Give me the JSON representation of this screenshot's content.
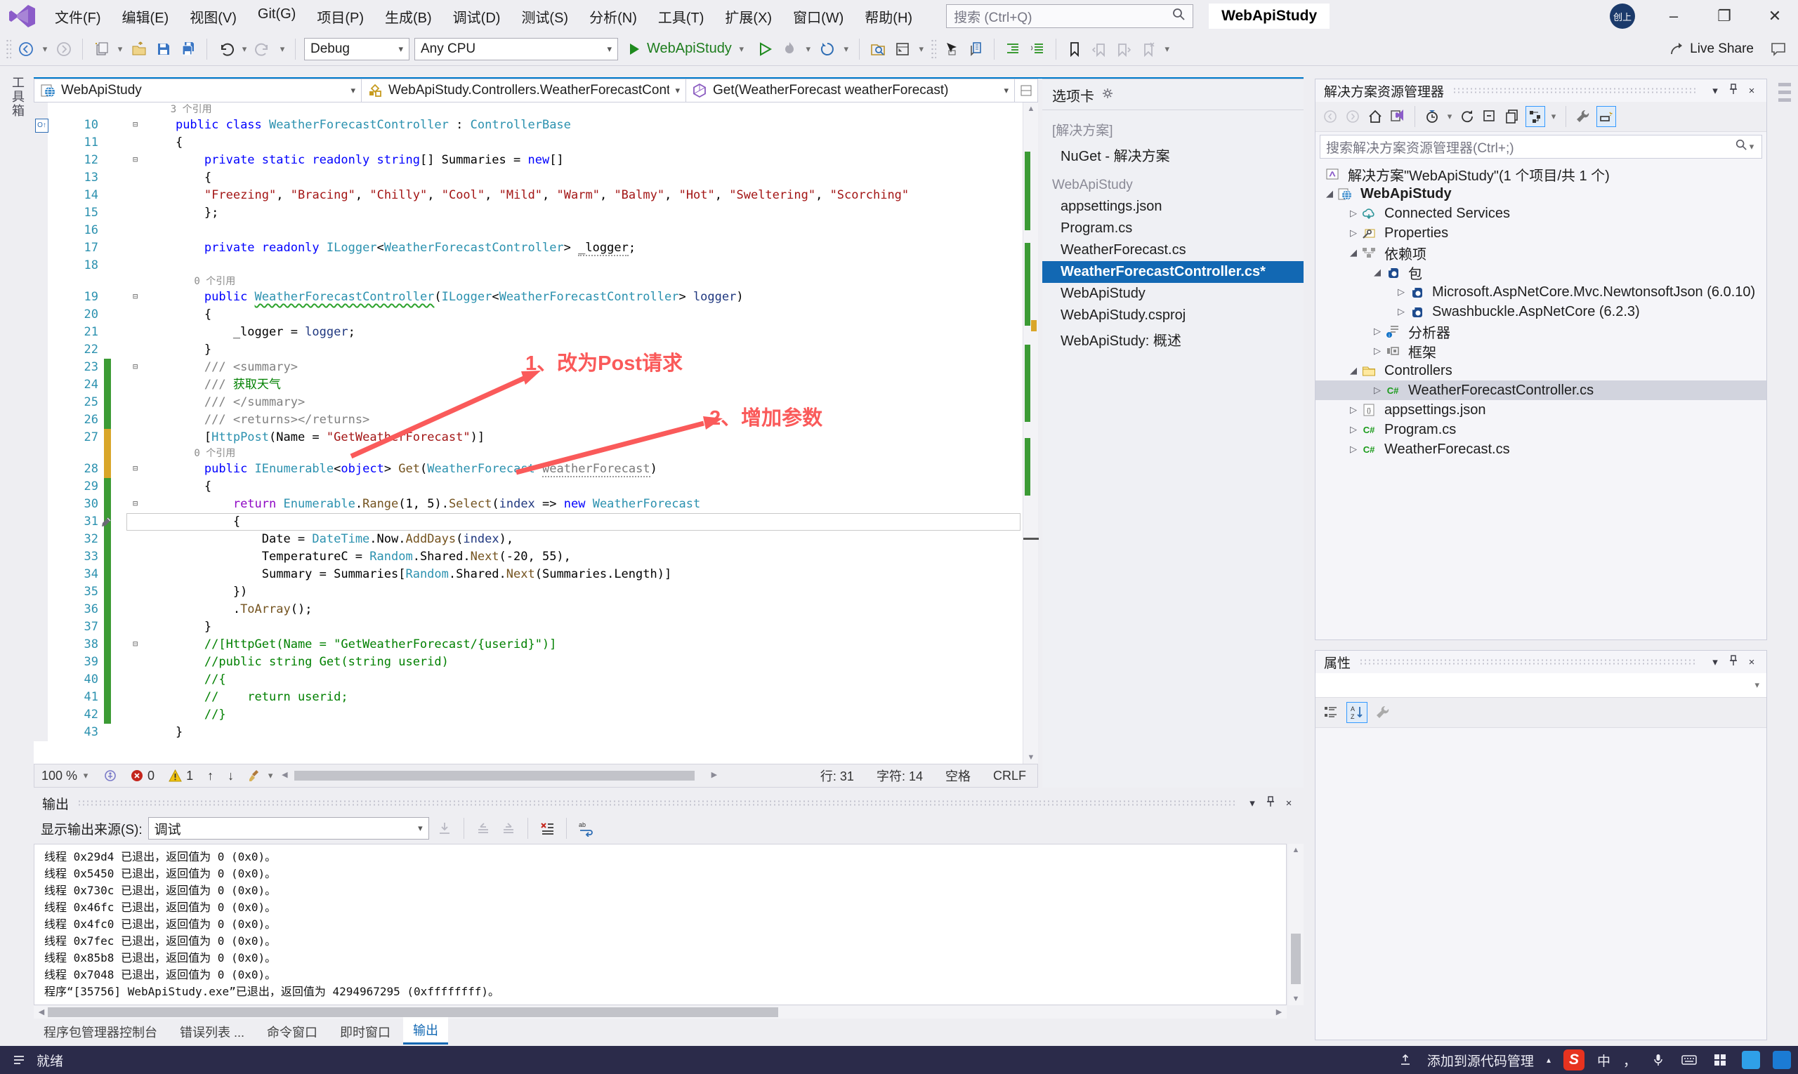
{
  "colors": {
    "accent": "#007ACC",
    "selection_blue": "#1268B3",
    "change_green": "#3C9B35",
    "change_orange": "#D9A629",
    "annotation_red": "#FA5A5A",
    "keyword_blue": "#0000FF",
    "type_teal": "#2B91AF",
    "string_red": "#A31515",
    "comment_green": "#008000"
  },
  "titlebar": {
    "menus": [
      "文件(F)",
      "编辑(E)",
      "视图(V)",
      "Git(G)",
      "项目(P)",
      "生成(B)",
      "调试(D)",
      "测试(S)",
      "分析(N)",
      "工具(T)",
      "扩展(X)",
      "窗口(W)",
      "帮助(H)"
    ],
    "search_placeholder": "搜索 (Ctrl+Q)",
    "window_title": "WebApiStudy",
    "avatar": "创上",
    "minimize": "–",
    "restore": "❐",
    "close": "✕"
  },
  "toolbar": {
    "configuration": "Debug",
    "platform": "Any CPU",
    "run_target": "WebApiStudy",
    "live_share": "Live Share"
  },
  "left_strip": {
    "toolbox_tab": "工具箱"
  },
  "navbar": {
    "project": "WebApiStudy",
    "type": "WebApiStudy.Controllers.WeatherForecastCont",
    "member": "Get(WeatherForecast weatherForecast)"
  },
  "editor": {
    "lines": [
      {
        "h": 1,
        "segs": [
          [
            "    3 个引用",
            "g"
          ]
        ]
      },
      {
        "n": "10",
        "fold": 1,
        "glyph": "ref",
        "segs": [
          [
            "    ",
            "x"
          ],
          [
            "public class ",
            "k"
          ],
          [
            "WeatherForecastController",
            "t"
          ],
          [
            " : ",
            "x"
          ],
          [
            "ControllerBase",
            "t"
          ]
        ]
      },
      {
        "n": "11",
        "segs": [
          [
            "    {",
            "x"
          ]
        ]
      },
      {
        "n": "12",
        "fold": 1,
        "segs": [
          [
            "        ",
            "x"
          ],
          [
            "private static readonly ",
            "k"
          ],
          [
            "string",
            "k"
          ],
          [
            "[] Summaries = ",
            "x"
          ],
          [
            "new",
            "k"
          ],
          [
            "[]",
            "x"
          ]
        ]
      },
      {
        "n": "13",
        "segs": [
          [
            "        {",
            "x"
          ]
        ]
      },
      {
        "n": "14",
        "segs": [
          [
            "        ",
            "x"
          ],
          [
            "\"Freezing\"",
            "s"
          ],
          [
            ", ",
            "x"
          ],
          [
            "\"Bracing\"",
            "s"
          ],
          [
            ", ",
            "x"
          ],
          [
            "\"Chilly\"",
            "s"
          ],
          [
            ", ",
            "x"
          ],
          [
            "\"Cool\"",
            "s"
          ],
          [
            ", ",
            "x"
          ],
          [
            "\"Mild\"",
            "s"
          ],
          [
            ", ",
            "x"
          ],
          [
            "\"Warm\"",
            "s"
          ],
          [
            ", ",
            "x"
          ],
          [
            "\"Balmy\"",
            "s"
          ],
          [
            ", ",
            "x"
          ],
          [
            "\"Hot\"",
            "s"
          ],
          [
            ", ",
            "x"
          ],
          [
            "\"Sweltering\"",
            "s"
          ],
          [
            ", ",
            "x"
          ],
          [
            "\"Scorching\"",
            "s"
          ]
        ]
      },
      {
        "n": "15",
        "segs": [
          [
            "        };",
            "x"
          ]
        ]
      },
      {
        "n": "16",
        "segs": []
      },
      {
        "n": "17",
        "segs": [
          [
            "        ",
            "x"
          ],
          [
            "private readonly ",
            "k"
          ],
          [
            "ILogger",
            "t"
          ],
          [
            "<",
            "x"
          ],
          [
            "WeatherForecastController",
            "t"
          ],
          [
            "> ",
            "x"
          ],
          [
            "_logger",
            "dot"
          ],
          [
            ";",
            "x"
          ]
        ]
      },
      {
        "n": "18",
        "segs": []
      },
      {
        "h": 1,
        "segs": [
          [
            "        0 个引用",
            "g"
          ]
        ]
      },
      {
        "n": "19",
        "fold": 1,
        "segs": [
          [
            "        ",
            "x"
          ],
          [
            "public ",
            "k"
          ],
          [
            "WeatherForecastController",
            "sqg"
          ],
          [
            "(",
            "x"
          ],
          [
            "ILogger",
            "t"
          ],
          [
            "<",
            "x"
          ],
          [
            "WeatherForecastController",
            "t"
          ],
          [
            "> ",
            "x"
          ],
          [
            "logger",
            "p"
          ],
          [
            ")",
            "x"
          ]
        ]
      },
      {
        "n": "20",
        "segs": [
          [
            "        {",
            "x"
          ]
        ]
      },
      {
        "n": "21",
        "segs": [
          [
            "            _logger = ",
            "x"
          ],
          [
            "logger",
            "p"
          ],
          [
            ";",
            "x"
          ]
        ]
      },
      {
        "n": "22",
        "segs": [
          [
            "        }",
            "x"
          ]
        ]
      },
      {
        "n": "23",
        "bar": "g",
        "fold": 1,
        "segs": [
          [
            "        ",
            "x"
          ],
          [
            "/// <summary>",
            "d"
          ]
        ]
      },
      {
        "n": "24",
        "bar": "g",
        "segs": [
          [
            "        ",
            "x"
          ],
          [
            "/// ",
            "d"
          ],
          [
            "获取天气",
            "c"
          ]
        ]
      },
      {
        "n": "25",
        "bar": "g",
        "segs": [
          [
            "        ",
            "x"
          ],
          [
            "/// </summary>",
            "d"
          ]
        ]
      },
      {
        "n": "26",
        "bar": "g",
        "segs": [
          [
            "        ",
            "x"
          ],
          [
            "/// <returns></returns>",
            "d"
          ]
        ]
      },
      {
        "n": "27",
        "bar": "o",
        "segs": [
          [
            "        [",
            "x"
          ],
          [
            "HttpPost",
            "t"
          ],
          [
            "(Name = ",
            "x"
          ],
          [
            "\"GetWeatherForecast\"",
            "s"
          ],
          [
            ")]",
            "x"
          ]
        ]
      },
      {
        "h": 1,
        "bar": "o",
        "segs": [
          [
            "        0 个引用",
            "g"
          ]
        ]
      },
      {
        "n": "28",
        "bar": "o",
        "fold": 1,
        "segs": [
          [
            "        ",
            "x"
          ],
          [
            "public ",
            "k"
          ],
          [
            "IEnumerable",
            "t"
          ],
          [
            "<",
            "x"
          ],
          [
            "object",
            "k"
          ],
          [
            "> ",
            "x"
          ],
          [
            "Get",
            "m"
          ],
          [
            "(",
            "x"
          ],
          [
            "WeatherForecast",
            "t"
          ],
          [
            " ",
            "x"
          ],
          [
            "weatherForecast",
            "udot"
          ],
          [
            ")",
            "x"
          ]
        ]
      },
      {
        "n": "29",
        "bar": "g",
        "segs": [
          [
            "        {",
            "x"
          ]
        ]
      },
      {
        "n": "30",
        "bar": "g",
        "fold": 1,
        "segs": [
          [
            "            ",
            "x"
          ],
          [
            "return ",
            "ctl"
          ],
          [
            "Enumerable",
            "t"
          ],
          [
            ".",
            "x"
          ],
          [
            "Range",
            "m"
          ],
          [
            "(1, 5).",
            "x"
          ],
          [
            "Select",
            "m"
          ],
          [
            "(",
            "x"
          ],
          [
            "index",
            "p"
          ],
          [
            " => ",
            "x"
          ],
          [
            "new ",
            "k"
          ],
          [
            "WeatherForecast",
            "t"
          ]
        ]
      },
      {
        "n": "31",
        "bar": "g",
        "cur": 1,
        "glyph": "pen",
        "segs": [
          [
            "            {",
            "x"
          ]
        ]
      },
      {
        "n": "32",
        "bar": "g",
        "segs": [
          [
            "                Date = ",
            "x"
          ],
          [
            "DateTime",
            "t"
          ],
          [
            ".Now.",
            "x"
          ],
          [
            "AddDays",
            "m"
          ],
          [
            "(",
            "x"
          ],
          [
            "index",
            "p"
          ],
          [
            "),",
            "x"
          ]
        ]
      },
      {
        "n": "33",
        "bar": "g",
        "segs": [
          [
            "                TemperatureC = ",
            "x"
          ],
          [
            "Random",
            "t"
          ],
          [
            ".Shared.",
            "x"
          ],
          [
            "Next",
            "m"
          ],
          [
            "(-20, 55),",
            "x"
          ]
        ]
      },
      {
        "n": "34",
        "bar": "g",
        "segs": [
          [
            "                Summary = Summaries[",
            "x"
          ],
          [
            "Random",
            "t"
          ],
          [
            ".Shared.",
            "x"
          ],
          [
            "Next",
            "m"
          ],
          [
            "(Summaries.Length)]",
            "x"
          ]
        ]
      },
      {
        "n": "35",
        "bar": "g",
        "segs": [
          [
            "            })",
            "x"
          ]
        ]
      },
      {
        "n": "36",
        "bar": "g",
        "segs": [
          [
            "            .",
            "x"
          ],
          [
            "ToArray",
            "m"
          ],
          [
            "();",
            "x"
          ]
        ]
      },
      {
        "n": "37",
        "bar": "g",
        "segs": [
          [
            "        }",
            "x"
          ]
        ]
      },
      {
        "n": "38",
        "bar": "g",
        "fold": 1,
        "segs": [
          [
            "        ",
            "x"
          ],
          [
            "//[HttpGet(Name = \"GetWeatherForecast/{userid}\")]",
            "c"
          ]
        ]
      },
      {
        "n": "39",
        "bar": "g",
        "segs": [
          [
            "        ",
            "x"
          ],
          [
            "//public string Get(string userid)",
            "c"
          ]
        ]
      },
      {
        "n": "40",
        "bar": "g",
        "segs": [
          [
            "        ",
            "x"
          ],
          [
            "//{",
            "c"
          ]
        ]
      },
      {
        "n": "41",
        "bar": "g",
        "segs": [
          [
            "        ",
            "x"
          ],
          [
            "//    return userid;",
            "c"
          ]
        ]
      },
      {
        "n": "42",
        "bar": "g",
        "segs": [
          [
            "        ",
            "x"
          ],
          [
            "//}",
            "c"
          ]
        ]
      },
      {
        "n": "43",
        "segs": [
          [
            "    }",
            "x"
          ]
        ]
      }
    ],
    "annotations": [
      {
        "text": "1、改为Post请求"
      },
      {
        "text": "2、增加参数"
      }
    ],
    "status": {
      "zoom": "100 %",
      "errors": "0",
      "warnings": "1",
      "line": "行: 31",
      "column": "字符: 14",
      "spaces": "空格",
      "line_ending": "CRLF"
    }
  },
  "tabwell": {
    "title": "选项卡",
    "groups": [
      {
        "header": "[解决方案]",
        "items": [
          {
            "label": "NuGet - 解决方案",
            "active": false
          }
        ]
      },
      {
        "header": "WebApiStudy",
        "items": [
          {
            "label": "appsettings.json",
            "active": false
          },
          {
            "label": "Program.cs",
            "active": false
          },
          {
            "label": "WeatherForecast.cs",
            "active": false
          },
          {
            "label": "WeatherForecastController.cs*",
            "active": true
          },
          {
            "label": "WebApiStudy",
            "active": false
          },
          {
            "label": "WebApiStudy.csproj",
            "active": false
          },
          {
            "label": "WebApiStudy: 概述",
            "active": false
          }
        ]
      }
    ]
  },
  "solution_explorer": {
    "title": "解决方案资源管理器",
    "search_placeholder": "搜索解决方案资源管理器(Ctrl+;)",
    "items": [
      {
        "lvl": 0,
        "arrow": "",
        "icon": "solution",
        "label": "解决方案\"WebApiStudy\"(1 个项目/共 1 个)",
        "bold": false,
        "selected": false
      },
      {
        "lvl": 1,
        "arrow": "exp",
        "icon": "globe",
        "label": "WebApiStudy",
        "bold": true,
        "selected": false
      },
      {
        "lvl": 2,
        "arrow": "col",
        "icon": "cloud",
        "label": "Connected Services",
        "bold": false,
        "selected": false
      },
      {
        "lvl": 2,
        "arrow": "col",
        "icon": "props",
        "label": "Properties",
        "bold": false,
        "selected": false
      },
      {
        "lvl": 2,
        "arrow": "exp",
        "icon": "dep",
        "label": "依赖项",
        "bold": false,
        "selected": false
      },
      {
        "lvl": 3,
        "arrow": "exp",
        "icon": "pkg",
        "label": "包",
        "bold": false,
        "selected": false
      },
      {
        "lvl": 4,
        "arrow": "col",
        "icon": "pkg",
        "label": "Microsoft.AspNetCore.Mvc.NewtonsoftJson (6.0.10)",
        "bold": false,
        "selected": false
      },
      {
        "lvl": 4,
        "arrow": "col",
        "icon": "pkg",
        "label": "Swashbuckle.AspNetCore (6.2.3)",
        "bold": false,
        "selected": false
      },
      {
        "lvl": 3,
        "arrow": "col",
        "icon": "analyzer",
        "label": "分析器",
        "bold": false,
        "selected": false
      },
      {
        "lvl": 3,
        "arrow": "col",
        "icon": "framework",
        "label": "框架",
        "bold": false,
        "selected": false
      },
      {
        "lvl": 2,
        "arrow": "exp",
        "icon": "folder",
        "label": "Controllers",
        "bold": false,
        "selected": false
      },
      {
        "lvl": 3,
        "arrow": "col",
        "icon": "cs",
        "label": "WeatherForecastController.cs",
        "bold": false,
        "selected": true
      },
      {
        "lvl": 2,
        "arrow": "col",
        "icon": "json",
        "label": "appsettings.json",
        "bold": false,
        "selected": false
      },
      {
        "lvl": 2,
        "arrow": "col",
        "icon": "cs",
        "label": "Program.cs",
        "bold": false,
        "selected": false
      },
      {
        "lvl": 2,
        "arrow": "col",
        "icon": "cs",
        "label": "WeatherForecast.cs",
        "bold": false,
        "selected": false
      }
    ]
  },
  "properties_panel": {
    "title": "属性"
  },
  "output": {
    "title": "输出",
    "source_label": "显示输出来源(S):",
    "source_value": "调试",
    "lines": [
      "线程 0x29d4 已退出，返回值为 0 (0x0)。",
      "线程 0x5450 已退出，返回值为 0 (0x0)。",
      "线程 0x730c 已退出，返回值为 0 (0x0)。",
      "线程 0x46fc 已退出，返回值为 0 (0x0)。",
      "线程 0x4fc0 已退出，返回值为 0 (0x0)。",
      "线程 0x7fec 已退出，返回值为 0 (0x0)。",
      "线程 0x85b8 已退出，返回值为 0 (0x0)。",
      "线程 0x7048 已退出，返回值为 0 (0x0)。",
      "程序“[35756] WebApiStudy.exe”已退出，返回值为 4294967295 (0xffffffff)。"
    ]
  },
  "bottom_tabs": [
    {
      "label": "程序包管理器控制台",
      "active": false
    },
    {
      "label": "错误列表 ...",
      "active": false
    },
    {
      "label": "命令窗口",
      "active": false
    },
    {
      "label": "即时窗口",
      "active": false
    },
    {
      "label": "输出",
      "active": true
    }
  ],
  "statusbar": {
    "ready": "就绪",
    "source_control": "添加到源代码管理",
    "ime_mode": "中"
  }
}
